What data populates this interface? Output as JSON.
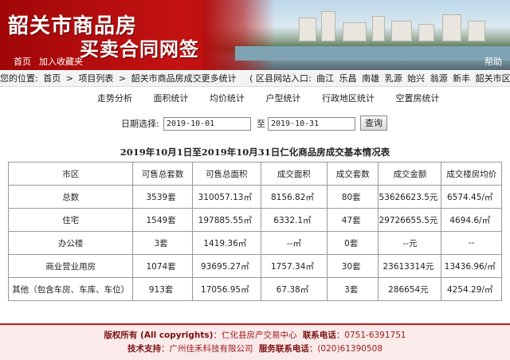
{
  "header": {
    "title_main": "韶关市商品房",
    "title_sub": "买卖合同网签",
    "links": {
      "home": "首页",
      "favorite": "加入收藏夹",
      "help": "帮助"
    }
  },
  "breadcrumb": {
    "prefix": "您的位置:",
    "items": [
      "首页",
      "项目列表",
      "韶关市商品房成交更多统计"
    ],
    "separator": ">",
    "district_label": "( 区县网站入口:",
    "districts": [
      "曲江",
      "乐昌",
      "南雄",
      "乳源",
      "始兴",
      "翁源",
      "新丰",
      "韶关市区"
    ],
    "district_close": ")"
  },
  "menu": {
    "items": [
      "走势分析",
      "面积统计",
      "均价统计",
      "户型统计",
      "行政地区统计",
      "空置房统计"
    ]
  },
  "filter": {
    "label": "日期选择:",
    "start_date": "2019-10-01",
    "to_label": "至",
    "end_date": "2019-10-31",
    "query_button": "查询"
  },
  "table": {
    "title": "2019年10月1日至2019年10月31日仁化商品房成交基本情况表",
    "headers": [
      "市区",
      "可售总套数",
      "可售总面积",
      "成交面积",
      "成交套数",
      "成交金额",
      "成交楼房均价"
    ],
    "rows": [
      [
        "总数",
        "3539套",
        "310057.13㎡",
        "8156.82㎡",
        "80套",
        "53626623.5元",
        "6574.45/㎡"
      ],
      [
        "住宅",
        "1549套",
        "197885.55㎡",
        "6332.1㎡",
        "47套",
        "29726655.5元",
        "4694.6/㎡"
      ],
      [
        "办公楼",
        "3套",
        "1419.36㎡",
        "--㎡",
        "0套",
        "--元",
        "--"
      ],
      [
        "商业营业用房",
        "1074套",
        "93695.27㎡",
        "1757.34㎡",
        "30套",
        "23613314元",
        "13436.96/㎡"
      ],
      [
        "其他（包含车房、车库、车位）",
        "913套",
        "17056.95㎡",
        "67.38㎡",
        "3套",
        "286654元",
        "4254.29/㎡"
      ]
    ]
  },
  "footer": {
    "line1": {
      "copyright_label": "版权所有 (All copyrights)",
      "copyright_value": "：仁化县房产交易中心",
      "phone_label": "联系电话",
      "phone_value": "：0751-6391751"
    },
    "line2": {
      "tech_label": "技术支持",
      "tech_value": "：广州佳禾科技有限公司",
      "service_label": "服务联系电话",
      "service_value": "：(020)61390508"
    }
  },
  "colors": {
    "brand_red": "#c41212",
    "footer_bg": "#fbeaea"
  }
}
